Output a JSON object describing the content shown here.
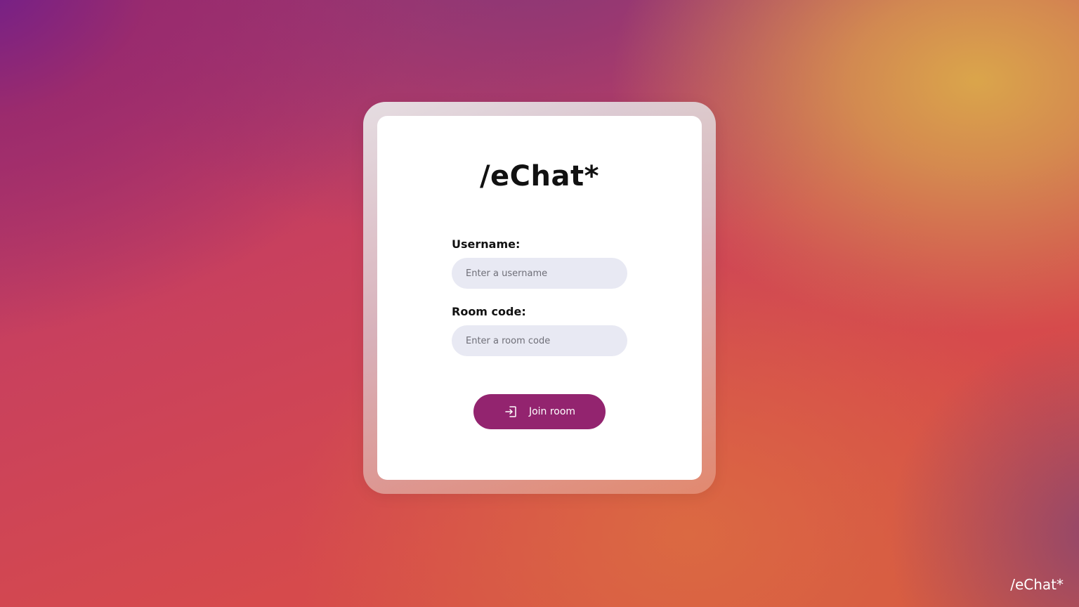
{
  "app": {
    "logo_text": "/eChat*",
    "corner_logo_text": "/eChat*"
  },
  "form": {
    "username": {
      "label": "Username:",
      "placeholder": "Enter a username",
      "value": ""
    },
    "room_code": {
      "label": "Room code:",
      "placeholder": "Enter a room code",
      "value": ""
    },
    "join_button": {
      "label": "Join room",
      "icon": "login-icon"
    }
  },
  "colors": {
    "button_accent": "#93246f",
    "input_background": "#e8e9f3",
    "card_background": "#ffffff"
  }
}
